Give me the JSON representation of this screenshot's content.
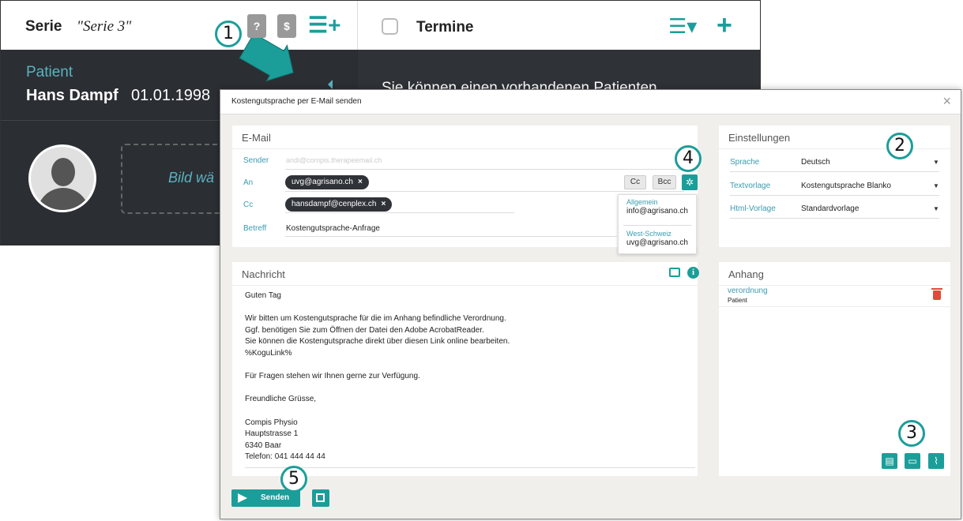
{
  "background": {
    "serie_label": "Serie",
    "serie_name": "\"Serie 3\"",
    "doc_question_icon": "?",
    "doc_dollar_icon": "$",
    "termine_label": "Termine",
    "patient_label": "Patient",
    "patient_name": "Hans Dampf",
    "patient_dob": "01.01.1998",
    "bild_label": "Bild wä",
    "right_text": "Sie können einen vorhandenen Patienten"
  },
  "modal": {
    "title": "Kostengutsprache per E-Mail senden",
    "close": "×",
    "email": {
      "heading": "E-Mail",
      "sender_label": "Sender",
      "sender_value": "andi@compis.therapeemail.ch",
      "an_label": "An",
      "an_chip": "uvg@agrisano.ch",
      "cc_label": "Cc",
      "cc_chip": "hansdampf@cenplex.ch",
      "betreff_label": "Betreff",
      "betreff_value": "Kostengutsprache-Anfrage",
      "cc_button": "Cc",
      "bcc_button": "Bcc",
      "chip_remove": "×"
    },
    "popup": {
      "groups": [
        {
          "name": "Allgemein",
          "email": "info@agrisano.ch"
        },
        {
          "name": "West-Schweiz",
          "email": "uvg@agrisano.ch"
        }
      ]
    },
    "settings": {
      "heading": "Einstellungen",
      "rows": [
        {
          "label": "Sprache",
          "value": "Deutsch"
        },
        {
          "label": "Textvorlage",
          "value": "Kostengutsprache Blanko"
        },
        {
          "label": "Html-Vorlage",
          "value": "Standardvorlage"
        }
      ]
    },
    "message": {
      "heading": "Nachricht",
      "info_icon": "i",
      "body": "Guten Tag\n\nWir bitten um Kostengutsprache für die im Anhang befindliche Verordnung.\nGgf. benötigen Sie zum Öffnen der Datei den Adobe AcrobatReader.\nSie können die Kostengutsprache direkt über diesen Link online bearbeiten.\n%KoguLink%\n\nFür Fragen stehen wir Ihnen gerne zur Verfügung.\n\nFreundliche Grüsse,\n\nCompis Physio\nHauptstrasse 1\n6340 Baar\nTelefon: 041 444 44 44"
    },
    "attachment": {
      "heading": "Anhang",
      "name": "verordnung",
      "sub": "Patient"
    },
    "send_label": "Senden"
  },
  "callouts": [
    "1",
    "2",
    "3",
    "4",
    "5"
  ],
  "colors": {
    "accent": "#1b9e9a",
    "dark": "#2b2e33",
    "delete": "#e04a3a"
  }
}
